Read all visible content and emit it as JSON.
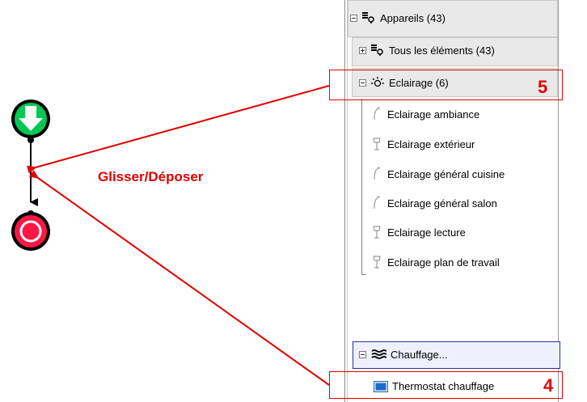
{
  "tree": {
    "appareils_label": "Appareils (43)",
    "tous_label": "Tous les éléments (43)",
    "eclairage_label": "Eclairage (6)",
    "eclairage_items": [
      "Eclairage ambiance",
      "Eclairage extérieur",
      "Eclairage général cuisine",
      "Eclairage général salon",
      "Eclairage lecture",
      "Eclairage plan de travail"
    ],
    "chauffage_label": "Chauffage...",
    "thermostat_label": "Thermostat chauffage"
  },
  "annotations": {
    "drag_drop_label": "Glisser/Déposer",
    "callout_eclairage_number": "5",
    "callout_thermostat_number": "4"
  },
  "colors": {
    "annotation_red": "#e00000",
    "start_green": "#00c853",
    "stop_red": "#ff1744",
    "selection_border": "#283593"
  },
  "icons": {
    "appareils": "devices-icon",
    "eclairage": "lightbulb-icon",
    "chauffage": "heating-icon",
    "thermostat": "thermostat-icon"
  }
}
